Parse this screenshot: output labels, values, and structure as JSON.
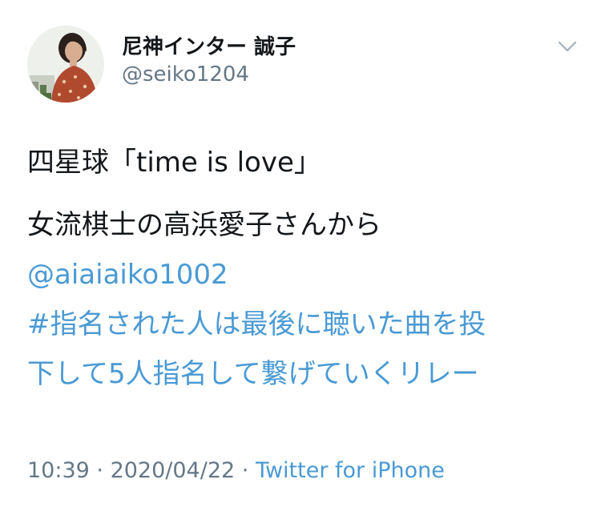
{
  "author": {
    "display_name": "尼神インター 誠子",
    "handle": "@seiko1204"
  },
  "tweet": {
    "line1": "四星球「time is love」",
    "line2": "女流棋士の高浜愛子さんから",
    "mention": "@aiaiaiko1002",
    "hashtag_line1": "#指名された人は最後に聴いた曲を投",
    "hashtag_line2": "下して5人指名して繋げていくリレー"
  },
  "meta": {
    "time": "10:39",
    "separator1": " · ",
    "date": "2020/04/22",
    "separator2": " · ",
    "source": "Twitter for iPhone"
  },
  "colors": {
    "link": "#4a9ad4",
    "secondary_text": "#657786",
    "primary_text": "#14171a"
  },
  "icons": {
    "menu": "chevron-down-icon",
    "avatar": "profile-photo"
  }
}
